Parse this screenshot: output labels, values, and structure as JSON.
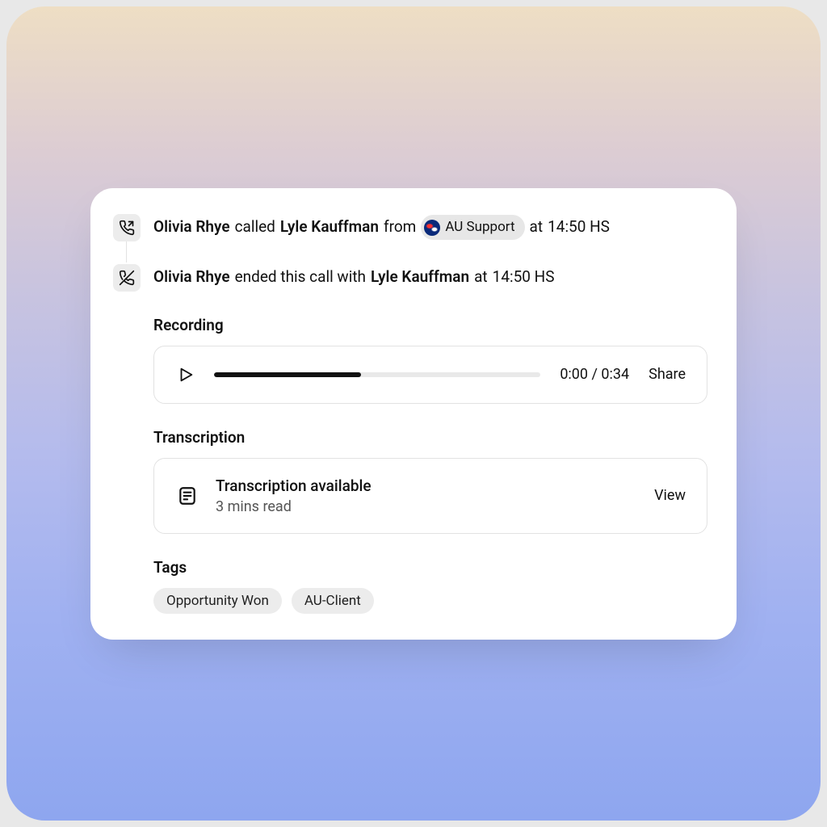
{
  "events": [
    {
      "caller": "Olivia Rhye",
      "verb": "called",
      "callee": "Lyle Kauffman",
      "from_word": "from",
      "source_label": "AU Support",
      "time_prefix": "at",
      "time": "14:50 HS"
    },
    {
      "caller": "Olivia Rhye",
      "verb": "ended this call with",
      "callee": "Lyle Kauffman",
      "time_prefix": "at",
      "time": "14:50 HS"
    }
  ],
  "recording": {
    "heading": "Recording",
    "elapsed": "0:00",
    "separator": "/",
    "total": "0:34",
    "share_label": "Share",
    "progress_percent": 45
  },
  "transcription": {
    "heading": "Transcription",
    "title": "Transcription available",
    "subtitle": "3 mins read",
    "view_label": "View"
  },
  "tags": {
    "heading": "Tags",
    "items": [
      "Opportunity Won",
      "AU-Client"
    ]
  }
}
